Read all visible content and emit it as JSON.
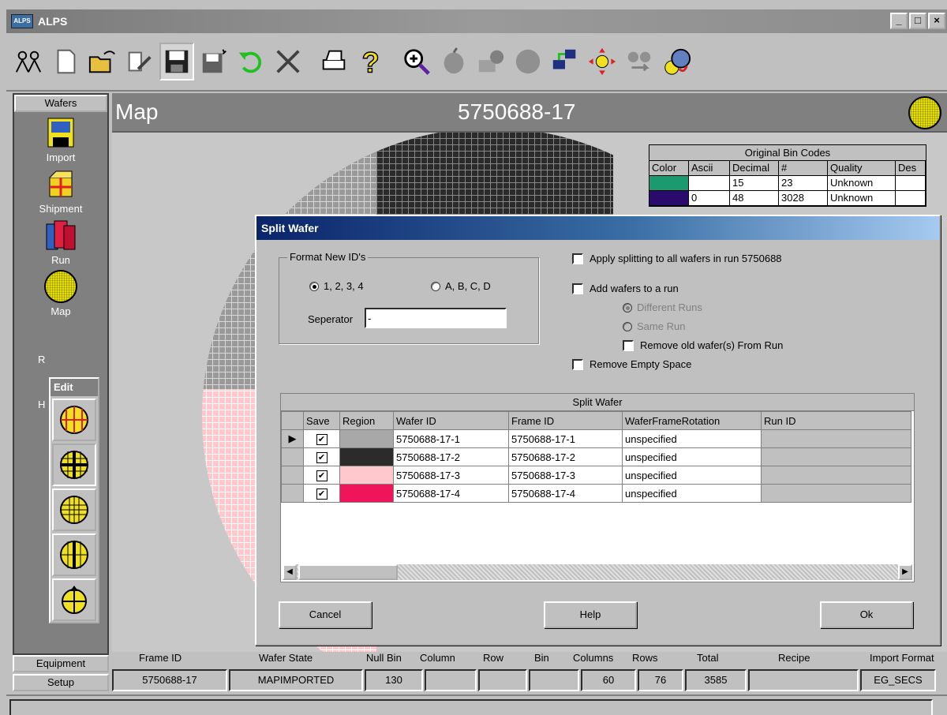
{
  "window": {
    "title": "ALPS",
    "app_icon": "ALPS",
    "min": "_",
    "max": "□",
    "close": "×"
  },
  "toolbar": {
    "icons": [
      "people-icon",
      "new-document-icon",
      "open-folder-icon",
      "edit-document-icon",
      "save-disk-icon",
      "save-as-icon",
      "undo-icon",
      "delete-x-icon",
      "print-icon",
      "help-question-icon",
      "zoom-icon",
      "apple-icon",
      "map-user-icon",
      "circle-icon",
      "network-icon",
      "move-arrows-icon",
      "transfer-icon",
      "wafer-rotate-icon"
    ]
  },
  "sidebar": {
    "top_tab": "Wafers",
    "items": [
      {
        "label": "Import",
        "icon": "import-disk-icon"
      },
      {
        "label": "Shipment",
        "icon": "shipment-box-icon"
      },
      {
        "label": "Run",
        "icon": "run-stack-icon"
      },
      {
        "label": "Map",
        "icon": "wafer-map-icon"
      },
      {
        "label": "R",
        "icon": "report-icon"
      },
      {
        "label": "H",
        "icon": "history-icon"
      }
    ],
    "bottom_tabs": [
      "Equipment",
      "Setup"
    ]
  },
  "edit_palette": {
    "title": "Edit"
  },
  "map": {
    "title": "Map",
    "wafer_id": "5750688-17"
  },
  "bin_codes": {
    "title": "Original Bin Codes",
    "headers": [
      "Color",
      "Ascii",
      "Decimal",
      "#",
      "Quality",
      "Des"
    ],
    "rows": [
      {
        "color": "#1a9a6e",
        "ascii": "",
        "decimal": "15",
        "count": "23",
        "quality": "Unknown"
      },
      {
        "color": "#2a0a6a",
        "ascii": "0",
        "decimal": "48",
        "count": "3028",
        "quality": "Unknown"
      }
    ]
  },
  "dialog": {
    "title": "Split Wafer",
    "format_group": "Format New ID's",
    "radio_numeric": "1, 2, 3, 4",
    "radio_alpha": "A, B, C, D",
    "separator_label": "Seperator",
    "separator_value": "-",
    "apply_all": "Apply splitting to all wafers in run 5750688",
    "add_to_run": "Add wafers to a run",
    "different_runs": "Different Runs",
    "same_run": "Same Run",
    "remove_old": "Remove old wafer(s) From Run",
    "remove_empty": "Remove Empty Space",
    "grid_caption": "Split Wafer",
    "columns": [
      "Save",
      "Region",
      "Wafer ID",
      "Frame ID",
      "WaferFrameRotation",
      "Run ID"
    ],
    "rows": [
      {
        "save": "✔",
        "region_color": "#a8a8a8",
        "wafer_id": "5750688-17-1",
        "frame_id": "5750688-17-1",
        "rotation": "unspecified",
        "run_id": ""
      },
      {
        "save": "✔",
        "region_color": "#2b2b2b",
        "wafer_id": "5750688-17-2",
        "frame_id": "5750688-17-2",
        "rotation": "unspecified",
        "run_id": ""
      },
      {
        "save": "✔",
        "region_color": "#ffc8cc",
        "wafer_id": "5750688-17-3",
        "frame_id": "5750688-17-3",
        "rotation": "unspecified",
        "run_id": ""
      },
      {
        "save": "✔",
        "region_color": "#f0145a",
        "wafer_id": "5750688-17-4",
        "frame_id": "5750688-17-4",
        "rotation": "unspecified",
        "run_id": ""
      }
    ],
    "cancel": "Cancel",
    "help": "Help",
    "ok": "Ok"
  },
  "status": {
    "labels": [
      "Frame ID",
      "Wafer State",
      "Null Bin",
      "Column",
      "Row",
      "Bin",
      "Columns",
      "Rows",
      "Total",
      "Recipe",
      "Import Format"
    ],
    "values": [
      "5750688-17",
      "MAPIMPORTED",
      "130",
      "",
      "",
      "",
      "60",
      "76",
      "3585",
      "",
      "EG_SECS"
    ]
  }
}
